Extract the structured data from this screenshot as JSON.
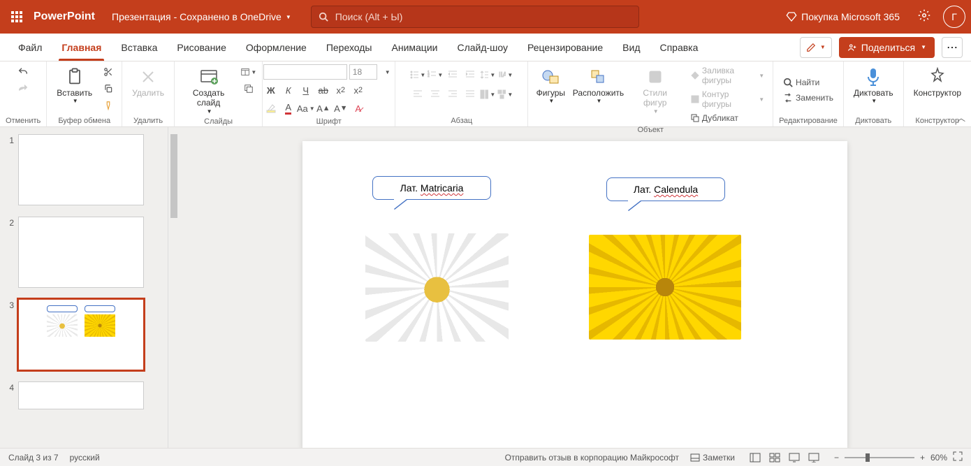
{
  "titlebar": {
    "app": "PowerPoint",
    "doc": "Презентация",
    "saved": " - Сохранено в OneDrive",
    "search_placeholder": "Поиск (Alt + Ы)",
    "buy": "Покупка Microsoft 365",
    "avatar": "Г"
  },
  "tabs": {
    "file": "Файл",
    "home": "Главная",
    "insert": "Вставка",
    "draw": "Рисование",
    "design": "Оформление",
    "transitions": "Переходы",
    "animations": "Анимации",
    "slideshow": "Слайд-шоу",
    "review": "Рецензирование",
    "view": "Вид",
    "help": "Справка",
    "share": "Поделиться"
  },
  "ribbon": {
    "undo_group": "Отменить",
    "clipboard": {
      "paste": "Вставить",
      "label": "Буфер обмена"
    },
    "delete": {
      "btn": "Удалить",
      "label": "Удалить"
    },
    "slides": {
      "new": "Создать слайд",
      "label": "Слайды"
    },
    "font": {
      "size": "18",
      "label": "Шрифт"
    },
    "paragraph": {
      "label": "Абзац"
    },
    "object": {
      "shapes": "Фигуры",
      "arrange": "Расположить",
      "styles": "Стили фигур",
      "fill": "Заливка фигуры",
      "outline": "Контур фигуры",
      "duplicate": "Дубликат",
      "label": "Объект"
    },
    "editing": {
      "find": "Найти",
      "replace": "Заменить",
      "label": "Редактирование"
    },
    "dictate": {
      "btn": "Диктовать",
      "label": "Диктовать"
    },
    "designer": {
      "btn": "Конструктор",
      "label": "Конструктор"
    }
  },
  "slide": {
    "callout1_prefix": "Лат. ",
    "callout1_word": "Matricaria",
    "callout2_prefix": "Лат. ",
    "callout2_word": "Calendula"
  },
  "thumbs": {
    "n1": "1",
    "n2": "2",
    "n3": "3",
    "n4": "4"
  },
  "status": {
    "slide": "Слайд 3 из 7",
    "lang": "русский",
    "feedback": "Отправить отзыв в корпорацию Майкрософт",
    "notes": "Заметки",
    "zoom": "60%"
  }
}
